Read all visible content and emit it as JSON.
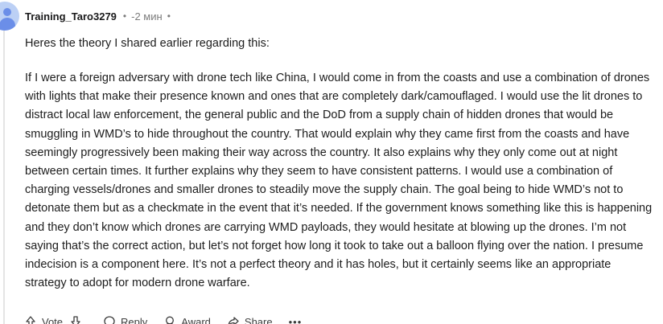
{
  "comment": {
    "username": "Training_Taro3279",
    "separator": "•",
    "timestamp": "-2 мин",
    "paragraphs": [
      "Heres the theory I shared earlier regarding this:",
      "If I were a foreign adversary with drone tech like China, I would come in from the coasts and use a combination of drones with lights that make their presence known and ones that are completely dark/camouflaged. I would use the lit drones to distract local law enforcement, the general public and the DoD from a supply chain of hidden drones that would be smuggling in WMD’s to hide throughout the country. That would explain why they came first from the coasts and have seemingly progressively been making their way across the country. It also explains why they only come out at night between certain times. It further explains why they seem to have consistent patterns. I would use a combination of charging vessels/drones and smaller drones to steadily move the supply chain. The goal being to hide WMD’s not to detonate them but as a checkmate in the event that it’s needed. If the government knows something like this is happening and they don’t know which drones are carrying WMD payloads, they would hesitate at blowing up the drones. I’m not saying that’s the correct action, but let’s not forget how long it took to take out a balloon flying over the nation. I presume indecision is a component here. It’s not a perfect theory and it has holes, but it certainly seems like an appropriate strategy to adopt for modern drone warfare."
    ]
  },
  "actions": {
    "vote_label": "Vote",
    "reply_label": "Reply",
    "award_label": "Award",
    "share_label": "Share",
    "more_label": "•••"
  },
  "icons": {
    "avatar": "default-user-avatar",
    "upvote": "arrow-up-icon",
    "downvote": "arrow-down-icon",
    "reply": "speech-bubble-icon",
    "award": "award-icon",
    "share": "share-arrow-icon",
    "more": "ellipsis-icon"
  },
  "colors": {
    "text": "#1c1c1c",
    "meta": "#7c7c7c",
    "avatar_bg": "#bcd0f5",
    "avatar_fg": "#6b8ee8"
  }
}
